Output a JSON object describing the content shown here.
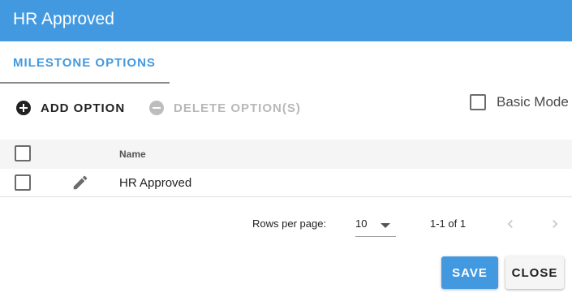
{
  "header": {
    "title": "HR Approved"
  },
  "tabs": [
    {
      "label": "MILESTONE OPTIONS"
    }
  ],
  "toolbar": {
    "add_label": "ADD OPTION",
    "delete_label": "DELETE OPTION(S)",
    "basic_mode_label": "Basic Mode"
  },
  "table": {
    "columns": [
      {
        "label": "Name"
      }
    ],
    "rows": [
      {
        "name": "HR Approved"
      }
    ]
  },
  "pagination": {
    "rows_per_page_label": "Rows per page:",
    "rows_per_page_value": "10",
    "range_text": "1-1 of 1"
  },
  "footer": {
    "save_label": "SAVE",
    "close_label": "CLOSE"
  },
  "colors": {
    "accent": "#4399e0",
    "disabled": "#b8b8b8"
  },
  "icons": {
    "add": "add-circle-icon",
    "delete": "remove-circle-icon",
    "edit": "pencil-icon",
    "prev": "chevron-left-icon",
    "next": "chevron-right-icon",
    "dropdown": "caret-down-icon"
  }
}
